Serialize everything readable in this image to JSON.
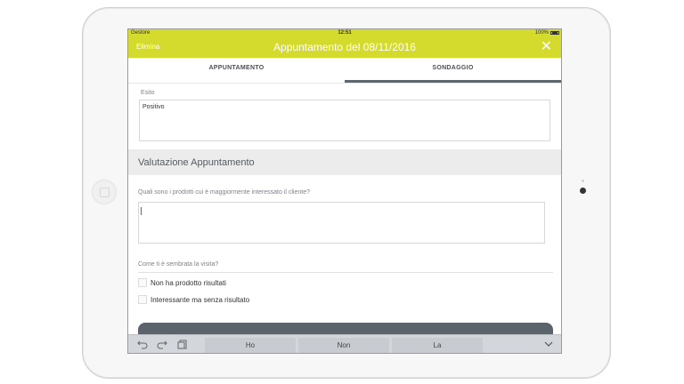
{
  "status_bar": {
    "carrier": "Gestore",
    "time": "12:51",
    "battery": "100%"
  },
  "nav": {
    "left_action": "Elimina",
    "title": "Appuntamento del 08/11/2016",
    "close_glyph": "✕"
  },
  "tabs": [
    {
      "label": "APPUNTAMENTO"
    },
    {
      "label": "SONDAGGIO"
    }
  ],
  "active_tab": "SONDAGGIO",
  "form": {
    "esito_label": "Esito",
    "esito_value": "Positivo",
    "section_title": "Valutazione Appuntamento",
    "prodotti_question": "Quali sono i prodotti cui è maggiormente interessato il cliente?",
    "prodotti_value": "",
    "visita_question": "Come ti è sembrata la visita?",
    "options": [
      {
        "label": "Non ha prodotto risultati",
        "checked": false
      },
      {
        "label": "Interessante ma senza risultato",
        "checked": false
      }
    ]
  },
  "keyboard_bar": {
    "undo_icon": "undo-icon",
    "redo_icon": "redo-icon",
    "paste_icon": "clipboard-icon",
    "suggestions": [
      "Ho",
      "Non",
      "La"
    ],
    "dismiss_icon": "chevron-down-icon"
  },
  "colors": {
    "accent": "#d4db2c",
    "section_bg": "#ececec",
    "submit_bg": "#5b636b"
  }
}
